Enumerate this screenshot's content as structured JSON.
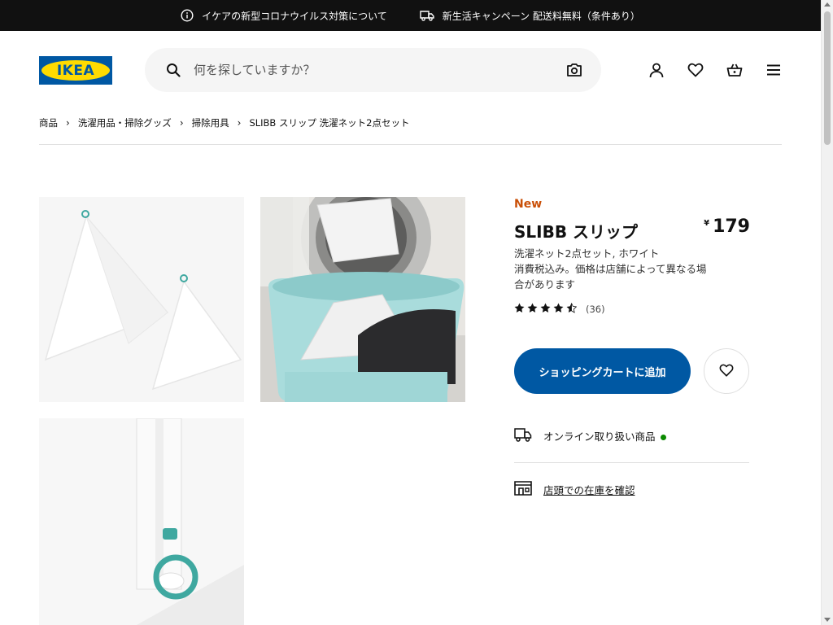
{
  "topbar": {
    "notice_covid": "イケアの新型コロナウイルス対策について",
    "notice_campaign": "新生活キャンペーン 配送料無料（条件あり）"
  },
  "header": {
    "logo_text": "IKEA",
    "search_placeholder": "何を探していますか？",
    "icons": [
      "search-icon",
      "camera-icon",
      "user-icon",
      "heart-icon",
      "bag-icon",
      "menu-icon"
    ]
  },
  "breadcrumb": {
    "items": [
      "商品",
      "洗濯用品・掃除グッズ",
      "掃除用具"
    ],
    "current": "SLIBB スリップ 洗濯ネット2点セット"
  },
  "product": {
    "badge": "New",
    "name": "SLIBB スリップ",
    "currency": "¥",
    "price": "179",
    "description_line1": "洗濯ネット2点セット, ホワイト",
    "description_line2": "消費税込み。価格は店舗によって異なる場合があります",
    "rating_value": 4.5,
    "rating_count": "(36)",
    "add_to_cart_label": "ショッピングカートに追加",
    "availability_online": "オンライン取り扱い商品",
    "availability_color": "#0a8a00",
    "check_store_stock": "店頭での在庫を確認"
  },
  "colors": {
    "brand_blue": "#0058a3",
    "brand_yellow": "#ffdb00",
    "new_badge": "#ca5008",
    "topbar_bg": "#111111"
  }
}
